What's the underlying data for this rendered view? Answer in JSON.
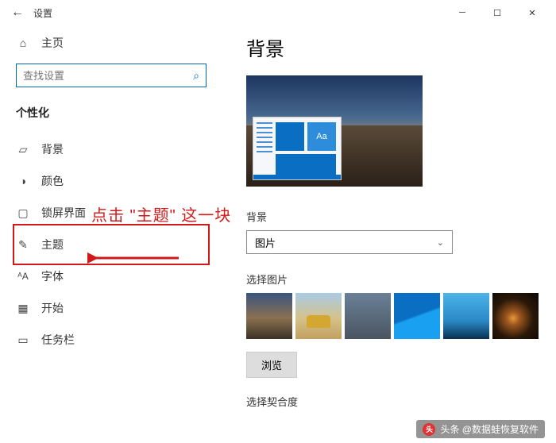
{
  "titlebar": {
    "title": "设置"
  },
  "sidebar": {
    "home": "主页",
    "search_placeholder": "查找设置",
    "section": "个性化",
    "items": [
      {
        "label": "背景"
      },
      {
        "label": "颜色"
      },
      {
        "label": "锁屏界面"
      },
      {
        "label": "主题"
      },
      {
        "label": "字体"
      },
      {
        "label": "开始"
      },
      {
        "label": "任务栏"
      }
    ]
  },
  "content": {
    "heading": "背景",
    "preview_tile_text": "Aa",
    "bg_label": "背景",
    "bg_value": "图片",
    "choose_label": "选择图片",
    "browse": "浏览",
    "fit_label": "选择契合度"
  },
  "annotation": "点击 \"主题\" 这一块",
  "watermark": "头条 @数据蛙恢复软件"
}
